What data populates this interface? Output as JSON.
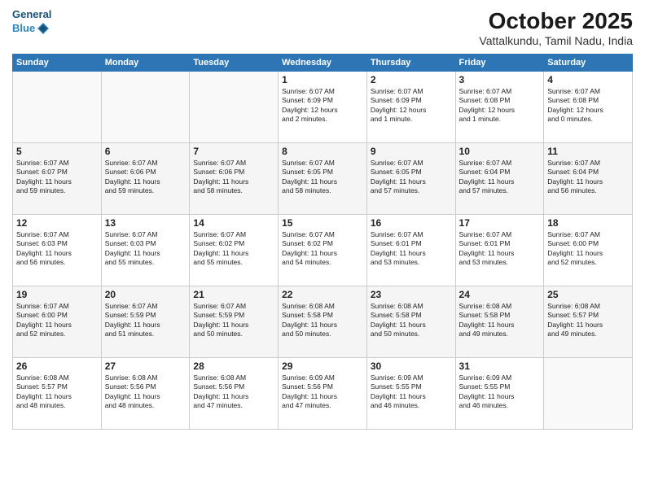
{
  "header": {
    "logo_line1": "General",
    "logo_line2": "Blue",
    "month": "October 2025",
    "location": "Vattalkundu, Tamil Nadu, India"
  },
  "weekdays": [
    "Sunday",
    "Monday",
    "Tuesday",
    "Wednesday",
    "Thursday",
    "Friday",
    "Saturday"
  ],
  "weeks": [
    [
      {
        "day": "",
        "info": ""
      },
      {
        "day": "",
        "info": ""
      },
      {
        "day": "",
        "info": ""
      },
      {
        "day": "1",
        "info": "Sunrise: 6:07 AM\nSunset: 6:09 PM\nDaylight: 12 hours\nand 2 minutes."
      },
      {
        "day": "2",
        "info": "Sunrise: 6:07 AM\nSunset: 6:09 PM\nDaylight: 12 hours\nand 1 minute."
      },
      {
        "day": "3",
        "info": "Sunrise: 6:07 AM\nSunset: 6:08 PM\nDaylight: 12 hours\nand 1 minute."
      },
      {
        "day": "4",
        "info": "Sunrise: 6:07 AM\nSunset: 6:08 PM\nDaylight: 12 hours\nand 0 minutes."
      }
    ],
    [
      {
        "day": "5",
        "info": "Sunrise: 6:07 AM\nSunset: 6:07 PM\nDaylight: 11 hours\nand 59 minutes."
      },
      {
        "day": "6",
        "info": "Sunrise: 6:07 AM\nSunset: 6:06 PM\nDaylight: 11 hours\nand 59 minutes."
      },
      {
        "day": "7",
        "info": "Sunrise: 6:07 AM\nSunset: 6:06 PM\nDaylight: 11 hours\nand 58 minutes."
      },
      {
        "day": "8",
        "info": "Sunrise: 6:07 AM\nSunset: 6:05 PM\nDaylight: 11 hours\nand 58 minutes."
      },
      {
        "day": "9",
        "info": "Sunrise: 6:07 AM\nSunset: 6:05 PM\nDaylight: 11 hours\nand 57 minutes."
      },
      {
        "day": "10",
        "info": "Sunrise: 6:07 AM\nSunset: 6:04 PM\nDaylight: 11 hours\nand 57 minutes."
      },
      {
        "day": "11",
        "info": "Sunrise: 6:07 AM\nSunset: 6:04 PM\nDaylight: 11 hours\nand 56 minutes."
      }
    ],
    [
      {
        "day": "12",
        "info": "Sunrise: 6:07 AM\nSunset: 6:03 PM\nDaylight: 11 hours\nand 56 minutes."
      },
      {
        "day": "13",
        "info": "Sunrise: 6:07 AM\nSunset: 6:03 PM\nDaylight: 11 hours\nand 55 minutes."
      },
      {
        "day": "14",
        "info": "Sunrise: 6:07 AM\nSunset: 6:02 PM\nDaylight: 11 hours\nand 55 minutes."
      },
      {
        "day": "15",
        "info": "Sunrise: 6:07 AM\nSunset: 6:02 PM\nDaylight: 11 hours\nand 54 minutes."
      },
      {
        "day": "16",
        "info": "Sunrise: 6:07 AM\nSunset: 6:01 PM\nDaylight: 11 hours\nand 53 minutes."
      },
      {
        "day": "17",
        "info": "Sunrise: 6:07 AM\nSunset: 6:01 PM\nDaylight: 11 hours\nand 53 minutes."
      },
      {
        "day": "18",
        "info": "Sunrise: 6:07 AM\nSunset: 6:00 PM\nDaylight: 11 hours\nand 52 minutes."
      }
    ],
    [
      {
        "day": "19",
        "info": "Sunrise: 6:07 AM\nSunset: 6:00 PM\nDaylight: 11 hours\nand 52 minutes."
      },
      {
        "day": "20",
        "info": "Sunrise: 6:07 AM\nSunset: 5:59 PM\nDaylight: 11 hours\nand 51 minutes."
      },
      {
        "day": "21",
        "info": "Sunrise: 6:07 AM\nSunset: 5:59 PM\nDaylight: 11 hours\nand 50 minutes."
      },
      {
        "day": "22",
        "info": "Sunrise: 6:08 AM\nSunset: 5:58 PM\nDaylight: 11 hours\nand 50 minutes."
      },
      {
        "day": "23",
        "info": "Sunrise: 6:08 AM\nSunset: 5:58 PM\nDaylight: 11 hours\nand 50 minutes."
      },
      {
        "day": "24",
        "info": "Sunrise: 6:08 AM\nSunset: 5:58 PM\nDaylight: 11 hours\nand 49 minutes."
      },
      {
        "day": "25",
        "info": "Sunrise: 6:08 AM\nSunset: 5:57 PM\nDaylight: 11 hours\nand 49 minutes."
      }
    ],
    [
      {
        "day": "26",
        "info": "Sunrise: 6:08 AM\nSunset: 5:57 PM\nDaylight: 11 hours\nand 48 minutes."
      },
      {
        "day": "27",
        "info": "Sunrise: 6:08 AM\nSunset: 5:56 PM\nDaylight: 11 hours\nand 48 minutes."
      },
      {
        "day": "28",
        "info": "Sunrise: 6:08 AM\nSunset: 5:56 PM\nDaylight: 11 hours\nand 47 minutes."
      },
      {
        "day": "29",
        "info": "Sunrise: 6:09 AM\nSunset: 5:56 PM\nDaylight: 11 hours\nand 47 minutes."
      },
      {
        "day": "30",
        "info": "Sunrise: 6:09 AM\nSunset: 5:55 PM\nDaylight: 11 hours\nand 46 minutes."
      },
      {
        "day": "31",
        "info": "Sunrise: 6:09 AM\nSunset: 5:55 PM\nDaylight: 11 hours\nand 46 minutes."
      },
      {
        "day": "",
        "info": ""
      }
    ]
  ]
}
